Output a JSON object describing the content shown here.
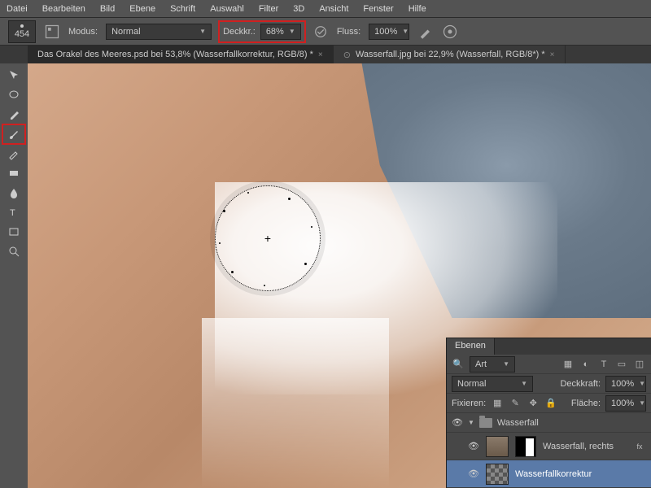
{
  "menu": [
    "Datei",
    "Bearbeiten",
    "Bild",
    "Ebene",
    "Schrift",
    "Auswahl",
    "Filter",
    "3D",
    "Ansicht",
    "Fenster",
    "Hilfe"
  ],
  "options": {
    "brush_size": "454",
    "mode_label": "Modus:",
    "mode_value": "Normal",
    "opacity_label": "Deckkr.:",
    "opacity_value": "68%",
    "flow_label": "Fluss:",
    "flow_value": "100%"
  },
  "tabs": {
    "active": "Das Orakel des Meeres.psd  bei 53,8% (Wasserfallkorrektur, RGB/8) *",
    "inactive": "Wasserfall.jpg bei 22,9% (Wasserfall, RGB/8*) *"
  },
  "layers_panel": {
    "title": "Ebenen",
    "filter": "Art",
    "blend": "Normal",
    "opacity_label": "Deckkraft:",
    "opacity_value": "100%",
    "lock_label": "Fixieren:",
    "fill_label": "Fläche:",
    "fill_value": "100%",
    "group": "Wasserfall",
    "layer1": "Wasserfall, rechts",
    "layer2": "Wasserfallkorrektur"
  }
}
